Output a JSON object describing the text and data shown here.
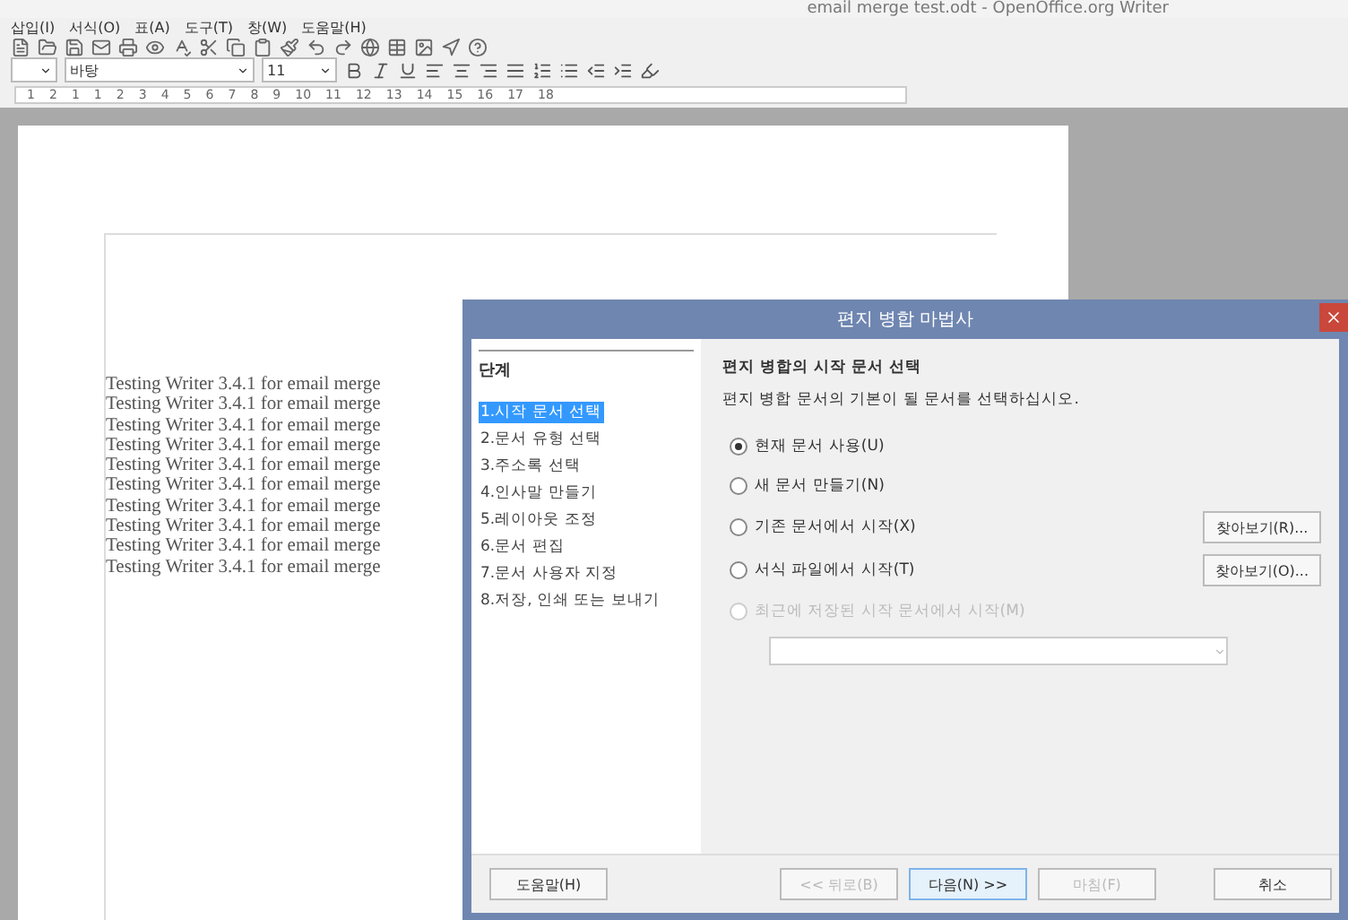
{
  "window": {
    "title": "email merge test.odt - OpenOffice.org Writer"
  },
  "menu": [
    "삽입(I)",
    "서식(O)",
    "표(A)",
    "도구(T)",
    "창(W)",
    "도움말(H)"
  ],
  "formatting": {
    "font": "바탕",
    "size": "11"
  },
  "ruler": [
    "1",
    "2",
    "1",
    "1",
    "2",
    "3",
    "4",
    "5",
    "6",
    "7",
    "8",
    "9",
    "10",
    "11",
    "12",
    "13",
    "14",
    "15",
    "16",
    "17",
    "18"
  ],
  "document": {
    "lines": [
      "Testing Writer 3.4.1 for email merge",
      "Testing Writer 3.4.1 for email merge",
      "Testing Writer 3.4.1 for email merge",
      "Testing Writer 3.4.1 for email merge",
      "Testing Writer 3.4.1 for email merge",
      "Testing Writer 3.4.1 for email merge",
      "Testing Writer 3.4.1 for email merge",
      "Testing Writer 3.4.1 for email merge",
      "Testing Writer 3.4.1 for email merge",
      "Testing Writer 3.4.1 for email merge"
    ]
  },
  "dialog": {
    "title": "편지 병합 마법사",
    "steps_heading": "단계",
    "steps": [
      {
        "label": "1.시작 문서 선택",
        "selected": true
      },
      {
        "label": "2.문서 유형 선택",
        "selected": false
      },
      {
        "label": "3.주소록 선택",
        "selected": false
      },
      {
        "label": "4.인사말 만들기",
        "selected": false
      },
      {
        "label": "5.레이아웃 조정",
        "selected": false
      },
      {
        "label": "6.문서 편집",
        "selected": false
      },
      {
        "label": "7.문서 사용자 지정",
        "selected": false
      },
      {
        "label": "8.저장, 인쇄 또는 보내기",
        "selected": false
      }
    ],
    "heading": "편지 병합의 시작 문서 선택",
    "description": "편지 병합 문서의 기본이 될 문서를 선택하십시오.",
    "options": [
      {
        "label": "현재 문서 사용(U)",
        "selected": true,
        "disabled": false
      },
      {
        "label": "새 문서 만들기(N)",
        "selected": false,
        "disabled": false
      },
      {
        "label": "기존 문서에서 시작(X)",
        "selected": false,
        "disabled": false,
        "button": "찾아보기(R)..."
      },
      {
        "label": "서식 파일에서 시작(T)",
        "selected": false,
        "disabled": false,
        "button": "찾아보기(O)..."
      },
      {
        "label": "최근에 저장된 시작 문서에서 시작(M)",
        "selected": false,
        "disabled": true
      }
    ],
    "buttons": [
      {
        "label": "도움말(H)",
        "disabled": false,
        "default": false
      },
      {
        "label": "<< 뒤로(B)",
        "disabled": true,
        "default": false
      },
      {
        "label": "다음(N) >>",
        "disabled": false,
        "default": true
      },
      {
        "label": "마침(F)",
        "disabled": true,
        "default": false
      },
      {
        "label": "취소",
        "disabled": false,
        "default": false
      }
    ]
  }
}
